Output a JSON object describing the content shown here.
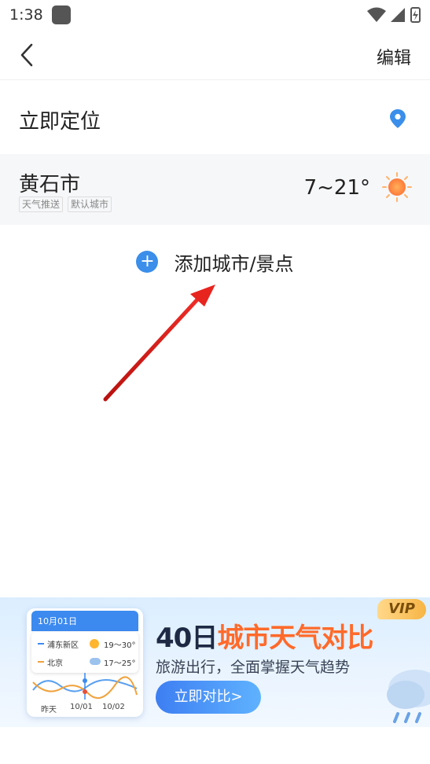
{
  "status_bar": {
    "time": "1:38",
    "icons": [
      "wifi-icon",
      "signal-icon",
      "battery-charging-icon"
    ]
  },
  "nav": {
    "back_icon": "chevron-left-icon",
    "edit_label": "编辑"
  },
  "locate": {
    "label": "立即定位",
    "icon": "location-pin-icon",
    "icon_color": "#3b8eea"
  },
  "cities": [
    {
      "name": "黄石市",
      "tags": [
        "天气推送",
        "默认城市"
      ],
      "temp_range": "7~21°",
      "weather_icon": "sun-icon"
    }
  ],
  "add_city": {
    "icon": "plus-circle-icon",
    "label": "添加城市/景点",
    "accent": "#3b8eea"
  },
  "annotation": {
    "type": "arrow",
    "color": "#d9201c"
  },
  "banner": {
    "vip_label": "VIP",
    "title_prefix": "40日",
    "title_accent": "城市天气对比",
    "subtitle": "旅游出行，全面掌握天气趋势",
    "button_label": "立即对比>",
    "mini_card": {
      "date": "10月01日",
      "rows": [
        {
          "city": "浦东新区",
          "temp": "19～30°",
          "icon": "sun-icon",
          "color": "#3c8af0"
        },
        {
          "city": "北京",
          "temp": "17～25°",
          "icon": "cloud-rain-icon",
          "color": "#f0a23c"
        }
      ],
      "x_labels": [
        "昨天",
        "10/01",
        "10/02"
      ]
    }
  }
}
